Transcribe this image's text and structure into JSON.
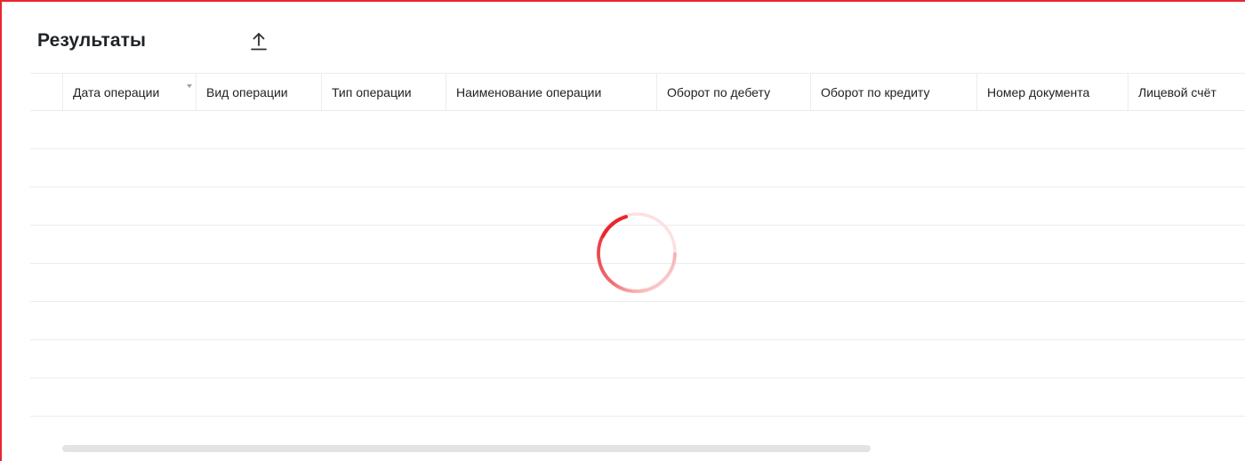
{
  "results_panel": {
    "title": "Результаты",
    "export_icon": "upload-icon"
  },
  "table": {
    "columns": [
      {
        "label": "Дата операции",
        "sortable": true
      },
      {
        "label": "Вид операции"
      },
      {
        "label": "Тип операции"
      },
      {
        "label": "Наименование операции"
      },
      {
        "label": "Оборот по дебету"
      },
      {
        "label": "Оборот по кредиту"
      },
      {
        "label": "Номер документа"
      },
      {
        "label": "Лицевой счёт"
      }
    ],
    "loading": true
  },
  "colors": {
    "accent": "#e8262e",
    "border": "#ececec",
    "text": "#222222"
  }
}
